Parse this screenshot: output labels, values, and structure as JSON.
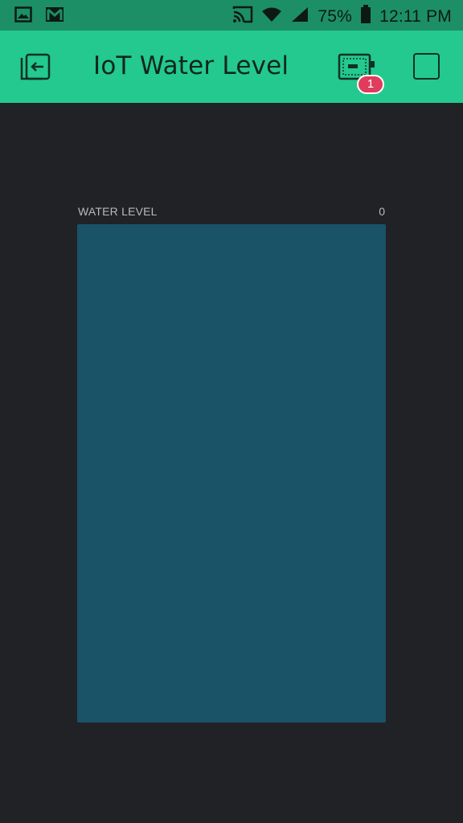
{
  "status_bar": {
    "left_icons": [
      "image-icon",
      "gmail-icon"
    ],
    "right_icons": [
      "cast-icon",
      "wifi-icon",
      "signal-icon",
      "battery-icon"
    ],
    "battery_percent": "75%",
    "time": "12:11 PM",
    "background_color": "#1c8f66"
  },
  "app_bar": {
    "title": "IoT Water Level",
    "back_icon": "exit-project-icon",
    "device_icon": "device-board-icon",
    "device_badge": "1",
    "action_icon": "stop-square-icon",
    "background_color": "#23c98e"
  },
  "widget": {
    "label": "WATER LEVEL",
    "value": "0",
    "level_fraction": 0,
    "track_color": "#1a5268",
    "fill_color": "#23c98e"
  }
}
